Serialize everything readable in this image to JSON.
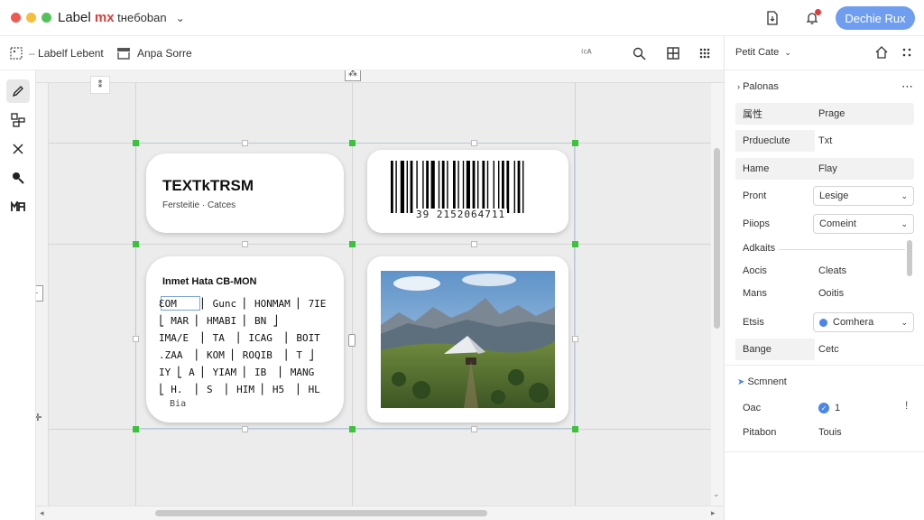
{
  "window": {
    "title_main": "Label ",
    "title_accent": "mx",
    "title_rest": " tнeбoban",
    "title_caret": "⌄",
    "action_button": "Dechie Rux"
  },
  "toolbar": {
    "item1_label": "Labelf Lebent",
    "item2_label": "Anpa Sorre",
    "small_label": "⁽ᶜᴬ"
  },
  "canvas": {
    "text_card": {
      "heading": "TEXTkTRSM",
      "subtext": "Fersteitie · Catces"
    },
    "barcode_card": {
      "digits": "39 2152064711"
    },
    "table_card": {
      "heading": "Inmet Hata CB-MON",
      "rows": [
        "ƐOM    ⎢ Gunc ⎢ HONMAM ⎢ 7IE",
        "⎣ MAR ⎢ HMABI ⎢ BN ⎦",
        "IMA/E  ⎢ TA  ⎢ ICAG  ⎢ BOIT",
        ".ZAA  ⎢ KOM ⎢ ROQIB  ⎢ T ⎦",
        "IY ⎣ A ⎢ YIAM ⎢ IB  ⎢ MANG",
        "⎣ H.  ⎢ S  ⎢ HIM ⎢ H5  ⎢ HL",
        "  Bia"
      ]
    },
    "image_card": {
      "image_label": "mountain-landscape"
    }
  },
  "panel": {
    "header": "Petit Cate",
    "section1": "Palonas",
    "rows": [
      {
        "k": "属性",
        "v": "Prage",
        "type": "text",
        "shaded": true
      },
      {
        "k": "Prdueclute",
        "v": "Txt",
        "type": "text",
        "shaded": true
      },
      {
        "k": "Hame",
        "v": "Flay",
        "type": "text",
        "shaded": true
      },
      {
        "k": "Pront",
        "v": "Lesige",
        "type": "select"
      },
      {
        "k": "Piiops",
        "v": "Comeint",
        "type": "select"
      }
    ],
    "section2": "Adkaits",
    "rows2": [
      {
        "k": "Aocis",
        "v": "Cleats"
      },
      {
        "k": "Mans",
        "v": "Ooitis"
      }
    ],
    "color_row": {
      "k": "Etsis",
      "v": "Comhera",
      "swatch": "#4a86e8"
    },
    "badge_row": {
      "k": "Bange",
      "v": "Cetc"
    },
    "section3": "Scmnent",
    "check_row": {
      "k": "Oac",
      "v": "1"
    },
    "last_row": {
      "k": "Pitabon",
      "v": "Touis"
    }
  },
  "colors": {
    "accent_blue": "#6f9ef0",
    "handle_green": "#3cc23c",
    "close_red": "#ee5a52",
    "min_yellow": "#f5bf3c",
    "max_green": "#52c35a"
  }
}
